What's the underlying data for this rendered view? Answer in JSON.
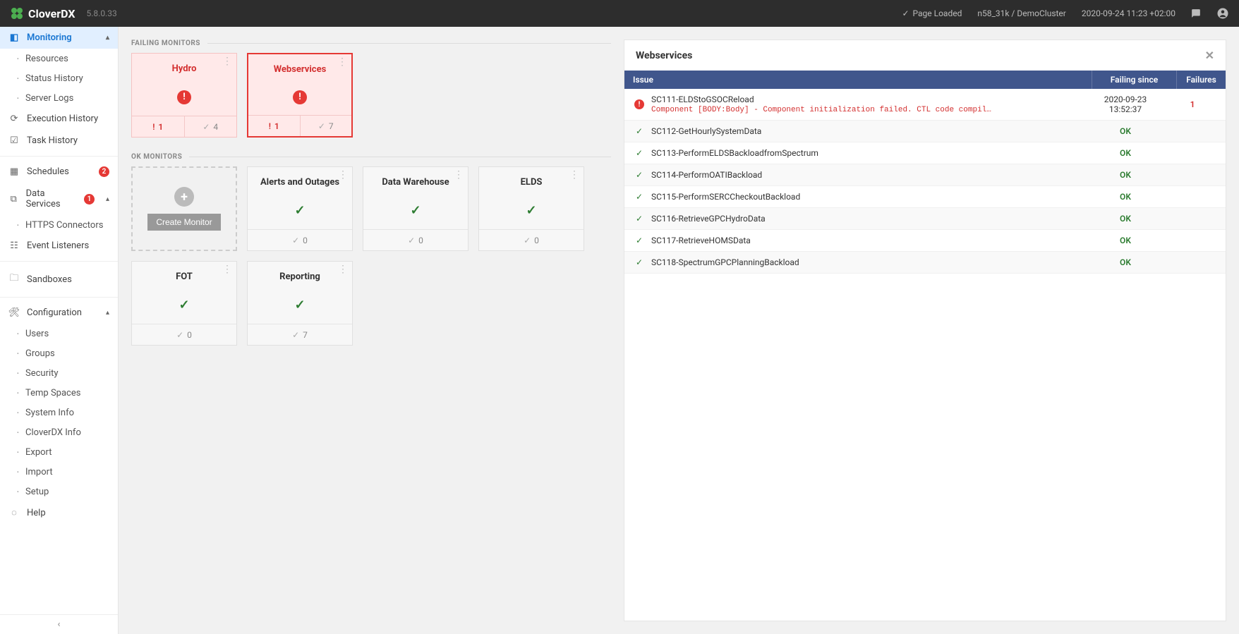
{
  "brand": {
    "name": "CloverDX",
    "version": "5.8.0.33"
  },
  "topbar": {
    "page_loaded": "Page Loaded",
    "cluster": "n58_31k / DemoCluster",
    "timestamp": "2020-09-24 11:23 +02:00"
  },
  "sidebar": {
    "monitoring": "Monitoring",
    "monitoring_children": [
      "Resources",
      "Status History",
      "Server Logs"
    ],
    "execution_history": "Execution History",
    "task_history": "Task History",
    "schedules": "Schedules",
    "schedules_badge": "2",
    "data_services": "Data Services",
    "data_services_badge": "1",
    "data_services_children": [
      "HTTPS Connectors"
    ],
    "event_listeners": "Event Listeners",
    "sandboxes": "Sandboxes",
    "configuration": "Configuration",
    "configuration_children": [
      "Users",
      "Groups",
      "Security",
      "Temp Spaces",
      "System Info",
      "CloverDX Info",
      "Export",
      "Import",
      "Setup"
    ],
    "help": "Help"
  },
  "monitors": {
    "failing_title": "FAILING MONITORS",
    "ok_title": "OK MONITORS",
    "create_label": "Create Monitor",
    "failing": [
      {
        "name": "Hydro",
        "fail": "1",
        "ok": "4",
        "selected": false
      },
      {
        "name": "Webservices",
        "fail": "1",
        "ok": "7",
        "selected": true
      }
    ],
    "ok": [
      {
        "name": "Alerts and Outages",
        "count": "0"
      },
      {
        "name": "Data Warehouse",
        "count": "0"
      },
      {
        "name": "ELDS",
        "count": "0"
      },
      {
        "name": "FOT",
        "count": "0"
      },
      {
        "name": "Reporting",
        "count": "7"
      }
    ]
  },
  "detail": {
    "title": "Webservices",
    "cols": {
      "issue": "Issue",
      "since": "Failing since",
      "failures": "Failures"
    },
    "rows": [
      {
        "status": "fail",
        "name": "SC111-ELDStoGSOCReload",
        "msg": "Component [BODY:Body] - Component initialization failed. CTL code compil…",
        "since_date": "2020-09-23",
        "since_time": "13:52:37",
        "failures": "1"
      },
      {
        "status": "ok",
        "name": "SC112-GetHourlySystemData",
        "ok": "OK"
      },
      {
        "status": "ok",
        "name": "SC113-PerformELDSBackloadfromSpectrum",
        "ok": "OK"
      },
      {
        "status": "ok",
        "name": "SC114-PerformOATIBackload",
        "ok": "OK"
      },
      {
        "status": "ok",
        "name": "SC115-PerformSERCCheckoutBackload",
        "ok": "OK"
      },
      {
        "status": "ok",
        "name": "SC116-RetrieveGPCHydroData",
        "ok": "OK"
      },
      {
        "status": "ok",
        "name": "SC117-RetrieveHOMSData",
        "ok": "OK"
      },
      {
        "status": "ok",
        "name": "SC118-SpectrumGPCPlanningBackload",
        "ok": "OK"
      }
    ]
  }
}
